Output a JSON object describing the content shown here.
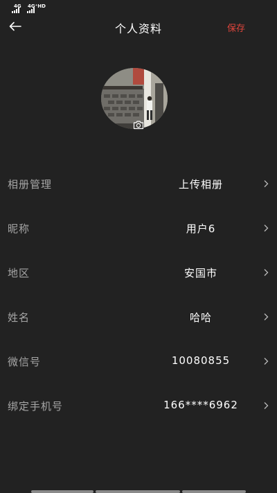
{
  "status_bar": {
    "network_1": "4G",
    "network_2": "4G⁺HD"
  },
  "header": {
    "title": "个人资料",
    "save_label": "保存",
    "back_icon": "arrow-left-icon"
  },
  "colors": {
    "background": "#222222",
    "accent": "#e0453c",
    "label": "#a6a6a6",
    "value": "#ffffff"
  },
  "profile": {
    "avatar_icon": "camera-icon",
    "rows": [
      {
        "label": "相册管理",
        "value": "上传相册"
      },
      {
        "label": "昵称",
        "value": "用户6"
      },
      {
        "label": "地区",
        "value": "安国市"
      },
      {
        "label": "姓名",
        "value": "哈哈"
      },
      {
        "label": "微信号",
        "value": "10080855"
      },
      {
        "label": "绑定手机号",
        "value": "166****6962"
      }
    ]
  }
}
